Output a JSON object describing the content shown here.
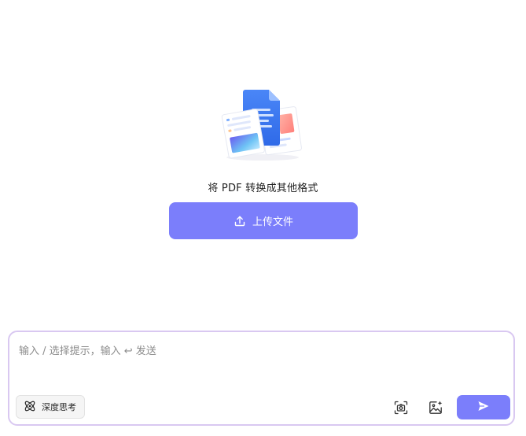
{
  "hero": {
    "title": "将 PDF 转换成其他格式",
    "upload_label": "上传文件"
  },
  "composer": {
    "placeholder": "输入 / 选择提示，输入 ↩ 发送",
    "deep_think_label": "深度思考"
  },
  "icons": {
    "illustration": "documents-illustration-icon",
    "upload": "upload-icon",
    "deep_think": "atom-icon",
    "camera": "camera-icon",
    "image": "image-sparkle-icon",
    "send": "send-icon"
  },
  "colors": {
    "accent": "#7b7efb",
    "composer_border": "#d9c8f1"
  }
}
